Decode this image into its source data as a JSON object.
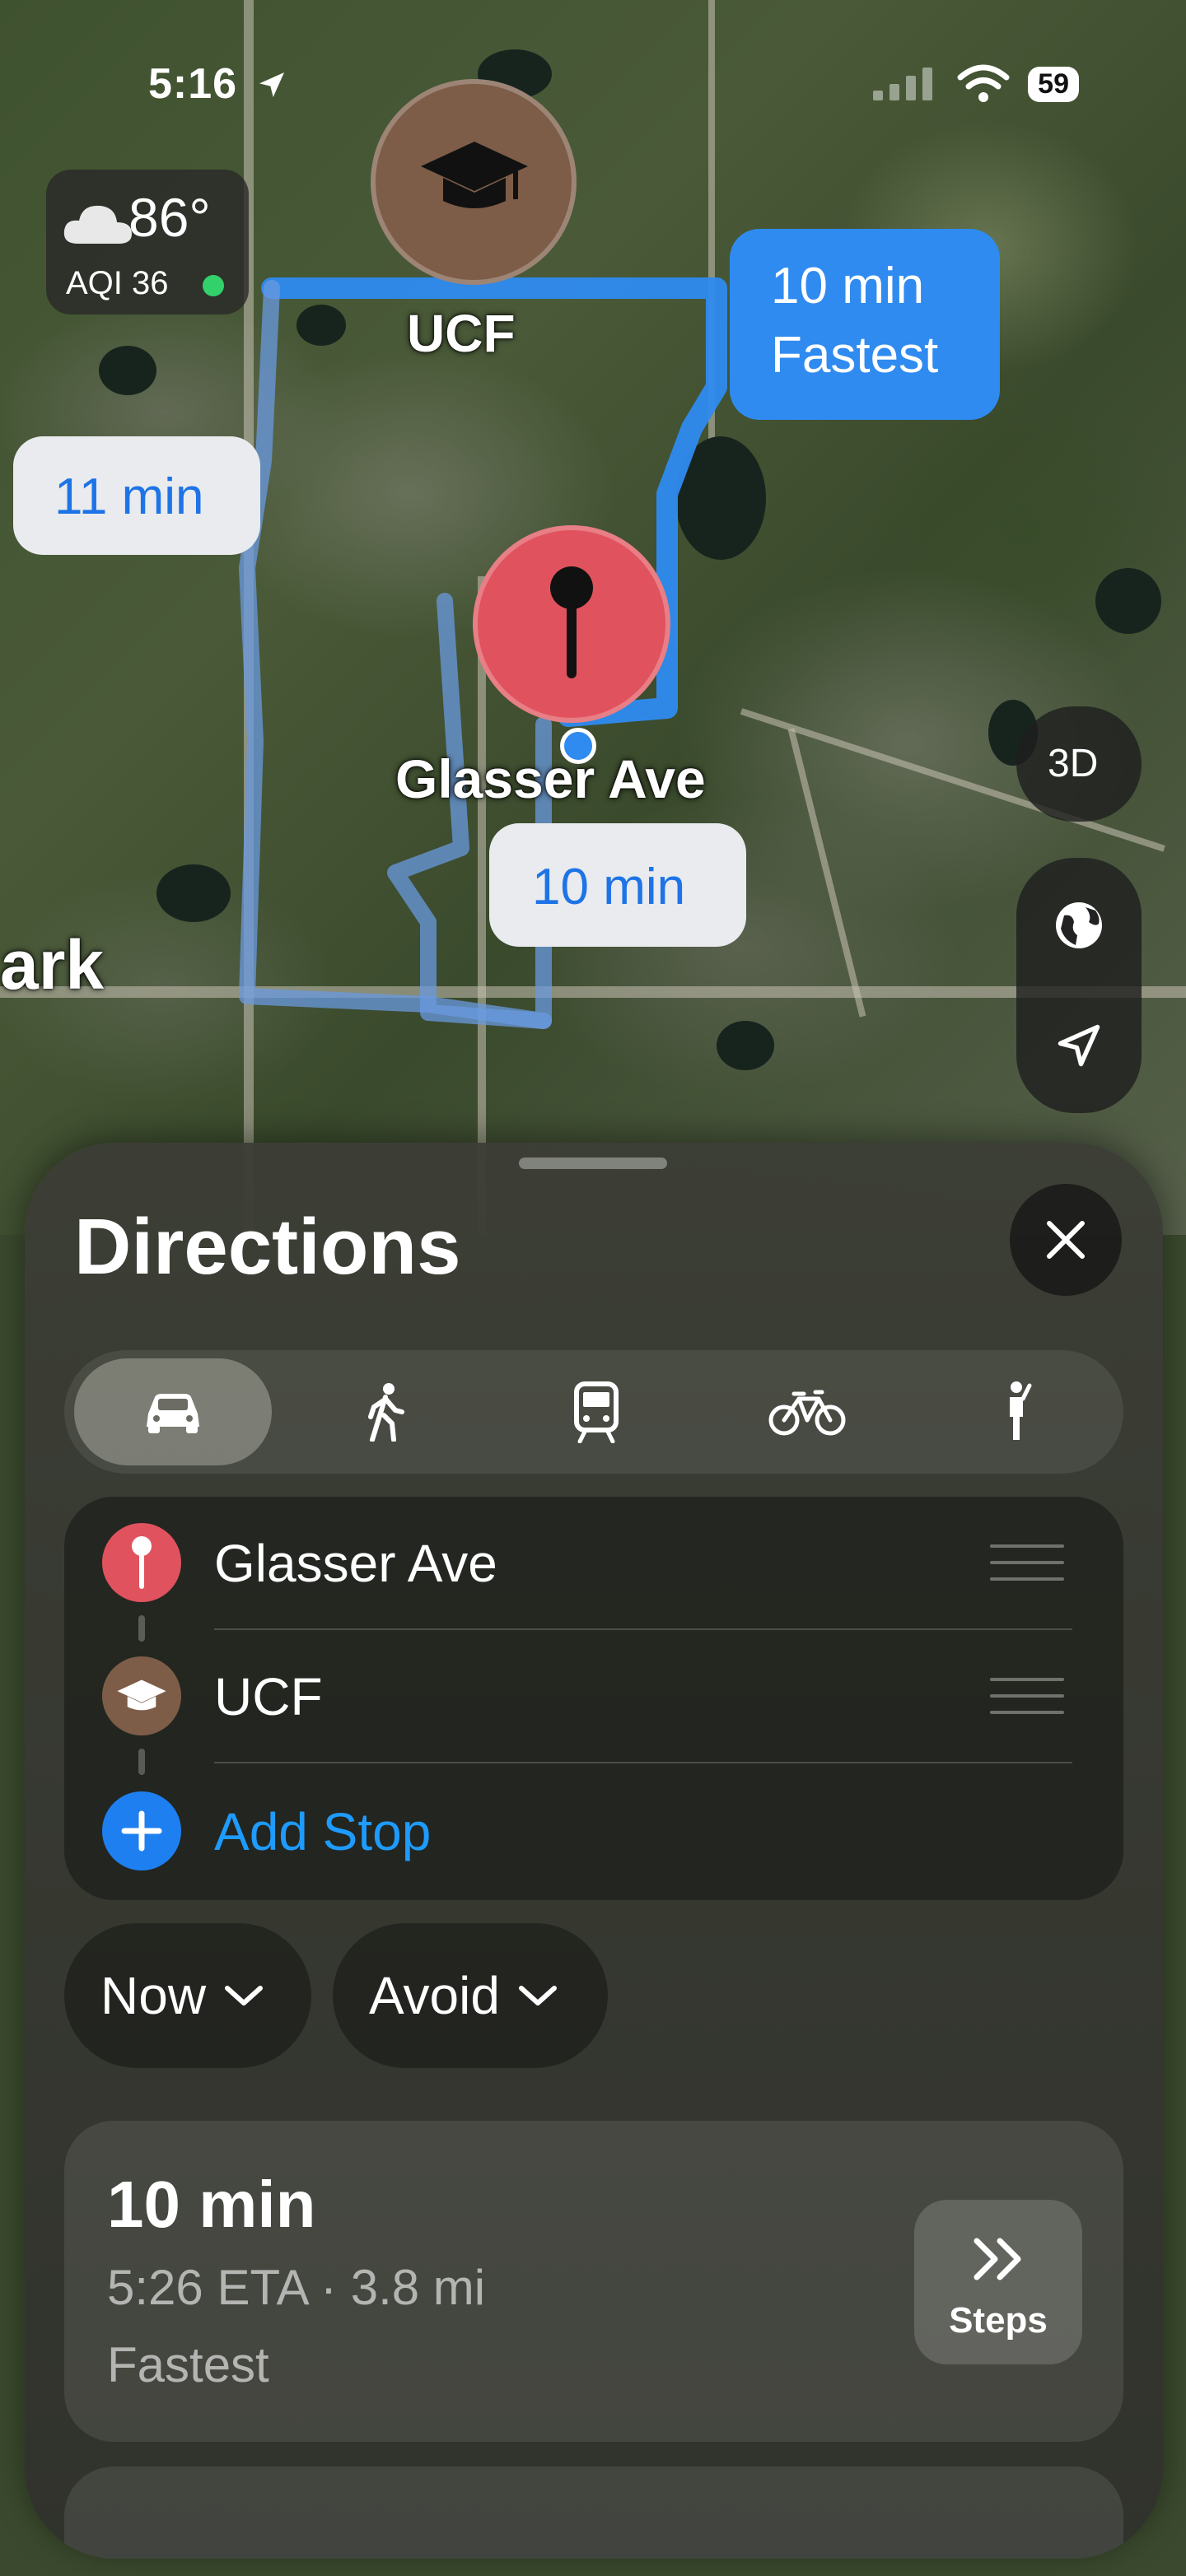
{
  "status_bar": {
    "time": "5:16",
    "battery": "59"
  },
  "weather": {
    "temperature": "86°",
    "aqi": "AQI 36"
  },
  "map": {
    "labels": {
      "origin": "UCF",
      "destination": "Glasser Ave",
      "edge_text": "ark"
    },
    "callouts": {
      "route_fastest_time": "10 min",
      "route_fastest_tag": "Fastest",
      "route_left_time": "11 min",
      "route_lower_time": "10 min"
    },
    "buttons": {
      "three_d": "3D"
    }
  },
  "sheet": {
    "title": "Directions",
    "modes": [
      "Drive",
      "Walk",
      "Transit",
      "Cycle",
      "Ride"
    ],
    "active_mode": "Drive",
    "stops": [
      {
        "label": "Glasser Ave",
        "icon": "pin-icon"
      },
      {
        "label": "UCF",
        "icon": "graduation-cap-icon"
      }
    ],
    "add_stop": "Add Stop",
    "options": {
      "time": "Now",
      "avoid": "Avoid"
    },
    "route": {
      "duration": "10 min",
      "details": "5:26 ETA · 3.8 mi",
      "tag": "Fastest",
      "steps_label": "Steps"
    }
  },
  "colors": {
    "route_blue": "#2f8bf0",
    "pin_red": "#e0535e",
    "accent": "#1e9bff"
  }
}
